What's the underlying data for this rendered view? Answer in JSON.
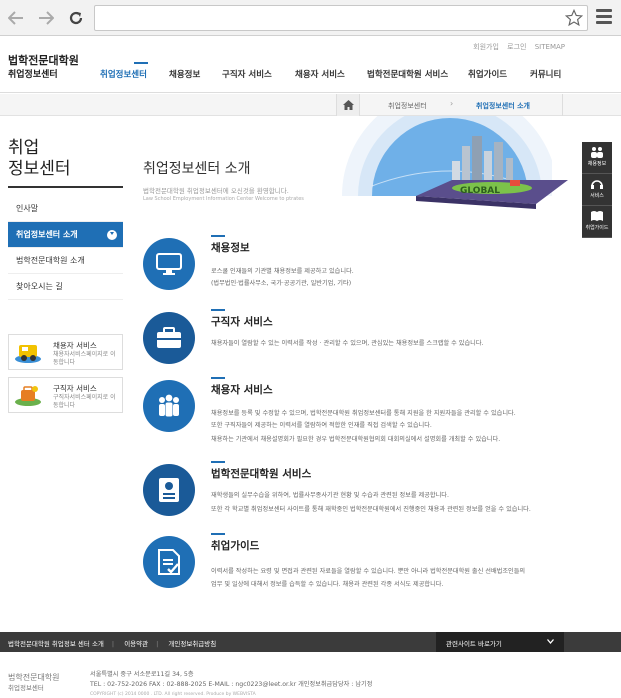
{
  "header": {
    "utility_links": [
      "회원가입",
      "로그인",
      "SITEMAP"
    ],
    "logo_title": "법학전문대학원",
    "logo_sub": "취업정보센터",
    "gnb": [
      "취업정보센터",
      "채용정보",
      "구직자 서비스",
      "채용자 서비스",
      "법학전문대학원 서비스",
      "취업가이드",
      "커뮤니티"
    ]
  },
  "breadcrumb": {
    "level1": "취업정보센터",
    "level2": "취업정보센터 소개"
  },
  "sidebar": {
    "title_line1": "취업",
    "title_line2": "정보센터",
    "items": [
      {
        "label": "인사말"
      },
      {
        "label": "취업정보센터 소개"
      },
      {
        "label": "법학전문대학원 소개"
      },
      {
        "label": "찾아오시는 길"
      }
    ],
    "banners": [
      {
        "title": "채용자 서비스",
        "desc": "채용자서비스페이지로 이동합니다"
      },
      {
        "title": "구직자 서비스",
        "desc": "구직자서비스페이지로 이동합니다"
      }
    ]
  },
  "main": {
    "title": "취업정보센터 소개",
    "welcome_ko": "법학전문대학원 취업정보센터에 오신것을 환영합니다.",
    "welcome_en": "Law School Employment Information Center Welcome to ptrates",
    "hero_label": "GLOBAL",
    "sections": [
      {
        "title": "채용정보",
        "lines": [
          "로스쿨 인재들의 기관별 채용정보를 제공하고 있습니다.",
          "(법무법인·법률사무소, 국가·공공기관, 일반기업, 기타)"
        ]
      },
      {
        "title": "구직자 서비스",
        "lines": [
          "채용자들이 열람할 수 있는 이력서를 작성 · 관리할 수 있으며, 관심있는 채용정보를 스크랩할 수 있습니다."
        ]
      },
      {
        "title": "채용자 서비스",
        "lines": [
          "채용정보를 등록 및 수정할 수 있으며, 법학전문대학원 취업정보센터를 통해 지원을 한 지원자들을 관리할 수 있습니다.",
          "또한 구직자들이 제공하는 이력서를 열람하여 적합한 인재를 직접 검색할 수 있습니다.",
          "채용하는 기관에서 채용설명회가 필요한 경우 법학전문대학원협의회 대회의실에서 설명회를 개최할 수 있습니다."
        ]
      },
      {
        "title": "법학전문대학원 서비스",
        "lines": [
          "재학생들의 실무수습을 위하여, 법률사무종사기관 현황 및 수습과 관련된 정보를 제공합니다.",
          "또한 각 학교별 취업정보센터 사이트를 통해 재학중인 법학전문대학원에서 진행중인 채용과 관련된 정보를 얻을 수 있습니다."
        ]
      },
      {
        "title": "취업가이드",
        "lines": [
          "이력서를 작성하는 요령 및 면접과 관련된 자료들을 열람할 수 있습니다. 뿐만 아니라 법학전문대학원 출신 선배법조인들의",
          "업무 및 일상에 대해서 정보를 습득할 수 있습니다. 채용과 관련된 각종 서식도 제공합니다."
        ]
      }
    ]
  },
  "quick_menu": [
    "채용정보",
    "서비스",
    "취업가이드"
  ],
  "footer": {
    "links": [
      "법학전문대학원 취업정보 센터 소개",
      "이용약관",
      "개인정보취급방침"
    ],
    "related": "관련사이트 바로가기",
    "logo_title": "법학전문대학원",
    "logo_sub": "취업정보센터",
    "address": "서울특별시 중구 서소문로11길 34, 5층",
    "tel": "TEL : 02-752-2026    FAX : 02-888-2025    E-MAIL : ngc0223@leet.or.kr    개인정보취급담당자 : 남기정",
    "copyright": "COPYRIGHT (c) 2014 0000 . LTD. All right reserved. Produce by WEBVISTA"
  },
  "colors": {
    "accent": "#1f6fb5",
    "footer_bg": "#3b3b3b"
  }
}
